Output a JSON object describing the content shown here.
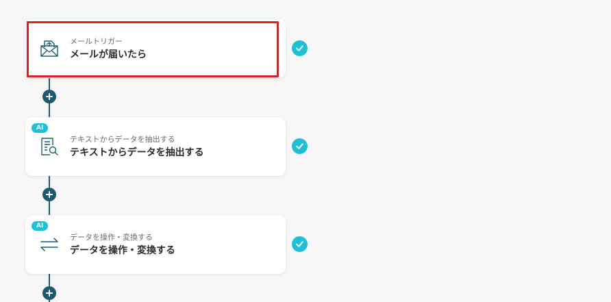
{
  "colors": {
    "accent": "#1cc1d6",
    "connector": "#1c5a72",
    "selection_border": "#e02020",
    "background": "#f7f7f7"
  },
  "steps": [
    {
      "subtitle": "メールトリガー",
      "title": "メールが届いたら",
      "icon": "mail-icon",
      "ai_badge": "",
      "selected": true,
      "status": "completed"
    },
    {
      "subtitle": "テキストからデータを抽出する",
      "title": "テキストからデータを抽出する",
      "icon": "document-search-icon",
      "ai_badge": "AI",
      "selected": false,
      "status": "completed"
    },
    {
      "subtitle": "データを操作・変換する",
      "title": "データを操作・変換する",
      "icon": "transform-arrows-icon",
      "ai_badge": "AI",
      "selected": false,
      "status": "completed"
    }
  ]
}
